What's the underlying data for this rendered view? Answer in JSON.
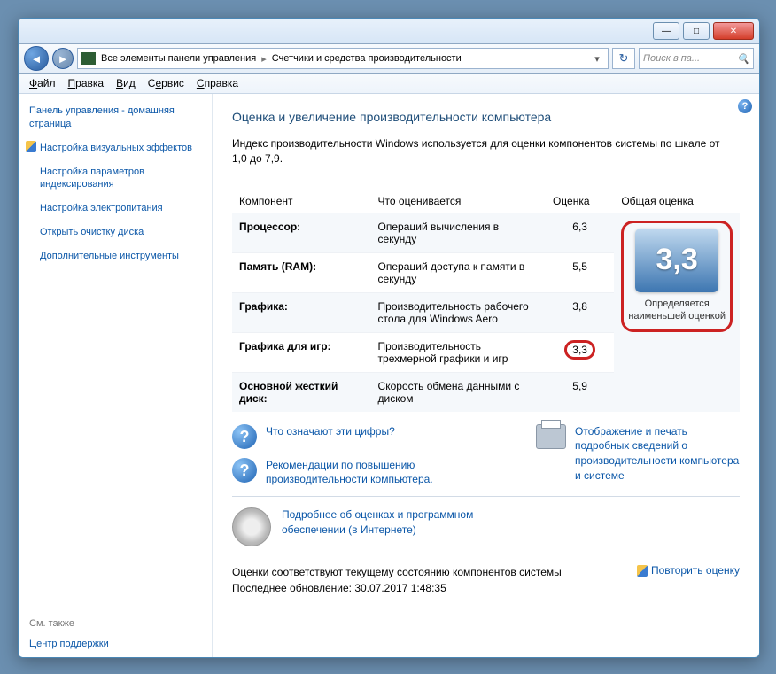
{
  "breadcrumb": {
    "root": "Все элементы панели управления",
    "current": "Счетчики и средства производительности"
  },
  "search": {
    "placeholder": "Поиск в па..."
  },
  "menu": {
    "file": "Файл",
    "edit": "Правка",
    "view": "Вид",
    "service": "Сервис",
    "help": "Справка"
  },
  "sidebar": {
    "home": "Панель управления - домашняя страница",
    "links": [
      "Настройка визуальных эффектов",
      "Настройка параметров индексирования",
      "Настройка электропитания",
      "Открыть очистку диска",
      "Дополнительные инструменты"
    ],
    "see_also": "См. также",
    "support": "Центр поддержки"
  },
  "main": {
    "title": "Оценка и увеличение производительности компьютера",
    "intro": "Индекс производительности Windows используется для оценки компонентов системы по шкале от 1,0 до 7,9.",
    "headers": {
      "component": "Компонент",
      "what": "Что оценивается",
      "score": "Оценка",
      "overall": "Общая оценка"
    },
    "rows": [
      {
        "name": "Процессор:",
        "desc": "Операций вычисления в секунду",
        "score": "6,3"
      },
      {
        "name": "Память (RAM):",
        "desc": "Операций доступа к памяти в секунду",
        "score": "5,5"
      },
      {
        "name": "Графика:",
        "desc": "Производительность рабочего стола для Windows Aero",
        "score": "3,8"
      },
      {
        "name": "Графика для игр:",
        "desc": "Производительность трехмерной графики и игр",
        "score": "3,3"
      },
      {
        "name": "Основной жесткий диск:",
        "desc": "Скорость обмена данными с диском",
        "score": "5,9"
      }
    ],
    "overall": {
      "score": "3,3",
      "label": "Определяется наименьшей оценкой"
    },
    "links": {
      "what_numbers": "Что означают эти цифры?",
      "recommend": "Рекомендации по повышению производительности компьютера.",
      "print": "Отображение и печать подробных сведений о производительности компьютера и системе",
      "details": "Подробнее об оценках и программном обеспечении (в Интернете)"
    },
    "footer": {
      "status": "Оценки соответствуют текущему состоянию компонентов системы",
      "updated": "Последнее обновление: 30.07.2017 1:48:35",
      "rerun": "Повторить оценку"
    }
  }
}
